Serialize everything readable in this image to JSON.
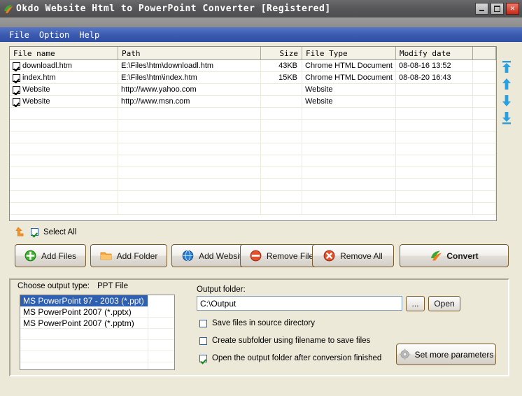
{
  "window": {
    "title": "Okdo Website Html to PowerPoint Converter  [Registered]",
    "icon": "app-swoosh-icon",
    "minimize_label": "–",
    "maximize_label": "□",
    "close_label": "✕"
  },
  "menu": {
    "items": [
      {
        "label": "File"
      },
      {
        "label": "Option"
      },
      {
        "label": "Help"
      }
    ]
  },
  "file_list": {
    "columns": [
      {
        "label": "File name"
      },
      {
        "label": "Path"
      },
      {
        "label": "Size"
      },
      {
        "label": "File Type"
      },
      {
        "label": "Modify date"
      },
      {
        "label": ""
      }
    ],
    "rows": [
      {
        "checked": true,
        "file_name": "downloadl.htm",
        "path": "E:\\Files\\htm\\downloadl.htm",
        "size": "43KB",
        "file_type": "Chrome HTML Document",
        "modify_date": "08-08-16 13:52"
      },
      {
        "checked": true,
        "file_name": "index.htm",
        "path": "E:\\Files\\htm\\index.htm",
        "size": "15KB",
        "file_type": "Chrome HTML Document",
        "modify_date": "08-08-20 16:43"
      },
      {
        "checked": true,
        "file_name": "Website",
        "path": "http://www.yahoo.com",
        "size": "",
        "file_type": "Website",
        "modify_date": ""
      },
      {
        "checked": true,
        "file_name": "Website",
        "path": "http://www.msn.com",
        "size": "",
        "file_type": "Website",
        "modify_date": ""
      }
    ],
    "empty_row_count": 9
  },
  "order_buttons": [
    {
      "name": "move-to-top",
      "icon": "arrow-to-top-icon"
    },
    {
      "name": "move-up",
      "icon": "arrow-up-icon"
    },
    {
      "name": "move-down",
      "icon": "arrow-down-icon"
    },
    {
      "name": "move-to-bottom",
      "icon": "arrow-to-bottom-icon"
    }
  ],
  "select_all": {
    "label": "Select All",
    "checked": true,
    "icon": "orange-up-arrow-icon"
  },
  "toolbar": {
    "add_files": {
      "label": "Add Files",
      "icon": "green-plus-icon"
    },
    "add_folder": {
      "label": "Add Folder",
      "icon": "orange-folder-icon"
    },
    "add_website": {
      "label": "Add Website",
      "icon": "blue-globe-icon"
    },
    "remove_file": {
      "label": "Remove File",
      "icon": "red-minus-icon"
    },
    "remove_all": {
      "label": "Remove All",
      "icon": "red-cross-icon"
    },
    "convert": {
      "label": "Convert",
      "icon": "convert-swoosh-icon"
    }
  },
  "output": {
    "type_label": "Choose output type:",
    "type_value": "PPT File",
    "types": [
      {
        "label": "MS PowerPoint 97 - 2003 (*.ppt)",
        "selected": true
      },
      {
        "label": "MS PowerPoint 2007 (*.pptx)",
        "selected": false
      },
      {
        "label": "MS PowerPoint 2007 (*.pptm)",
        "selected": false
      }
    ],
    "type_empty_rows": 5,
    "folder_label": "Output folder:",
    "folder_value": "C:\\Output",
    "folder_placeholder": "",
    "browse_label": "...",
    "open_label": "Open",
    "options": [
      {
        "label": "Save files in source directory",
        "checked": false
      },
      {
        "label": "Create subfolder using filename to save files",
        "checked": false
      },
      {
        "label": "Open the output folder after conversion finished",
        "checked": true
      }
    ],
    "set_more_parameters": {
      "label": "Set more parameters",
      "icon": "gear-icon"
    }
  },
  "colors": {
    "titlebar": "#58585a",
    "menubar": "#3b5bb0",
    "face": "#ece9d8",
    "selection": "#2f5fb0",
    "accent_orange": "#f08a1e",
    "accent_green": "#2ca02c"
  }
}
